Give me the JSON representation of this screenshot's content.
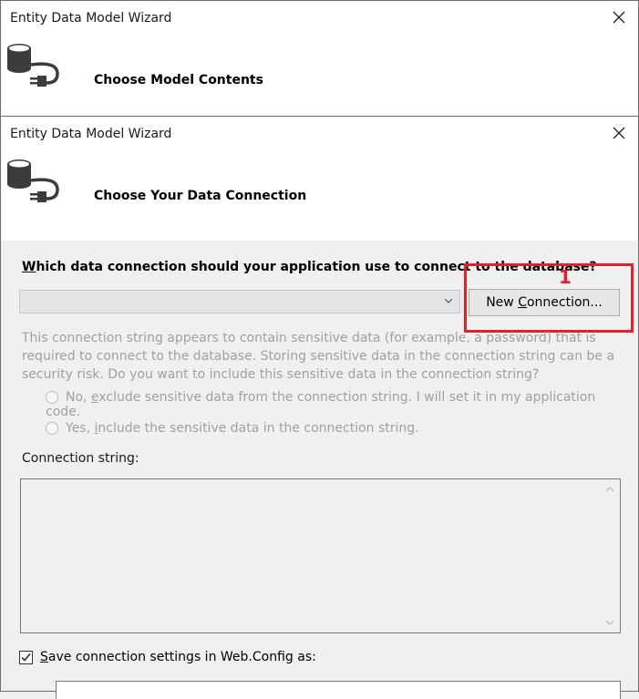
{
  "window1": {
    "title": "Entity Data Model Wizard",
    "subtitle": "Choose Model Contents"
  },
  "window2": {
    "title": "Entity Data Model Wizard",
    "subtitle": "Choose Your Data Connection"
  },
  "question": {
    "accel": "W",
    "rest": "hich data connection should your application use to connect to the database?"
  },
  "connection_combo": {
    "value": ""
  },
  "new_connection_button": {
    "pre": "New ",
    "accel": "C",
    "post": "onnection..."
  },
  "annotation": {
    "number": "1",
    "color": "#e0202a"
  },
  "sensitive_description": "This connection string appears to contain sensitive data (for example, a password) that is required to connect to the database. Storing sensitive data in the connection string can be a security risk. Do you want to include this sensitive data in the connection string?",
  "radio_no": {
    "pre": "No, ",
    "accel": "e",
    "post": "xclude sensitive data from the connection string. I will set it in my application code."
  },
  "radio_yes": {
    "pre": "Yes, ",
    "accel": "i",
    "post": "nclude the sensitive data in the connection string."
  },
  "connection_string_label": "Connection string:",
  "save_settings": {
    "accel": "S",
    "rest": "ave connection settings in Web.Config as:",
    "checked": true
  },
  "icons": {
    "close": "close-icon",
    "database": "database-plug-icon",
    "dropdown": "chevron-down-icon"
  }
}
